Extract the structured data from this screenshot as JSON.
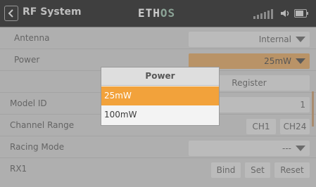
{
  "header": {
    "title": "RF System",
    "logo_a": "ETH",
    "logo_b": "OS"
  },
  "rows": {
    "antenna": {
      "label": "Antenna",
      "value": "Internal"
    },
    "power": {
      "label": "Power",
      "value": "25mW"
    },
    "register": {
      "label": "Register"
    },
    "model_id": {
      "label": "Model ID",
      "value": "1"
    },
    "channel_range": {
      "label": "Channel Range",
      "start": "CH1",
      "end": "CH24"
    },
    "racing_mode": {
      "label": "Racing Mode",
      "value": "---"
    },
    "rx1": {
      "label": "RX1",
      "bind": "Bind",
      "set": "Set",
      "reset": "Reset"
    }
  },
  "popup": {
    "title": "Power",
    "options": [
      "25mW",
      "100mW"
    ],
    "selected": "25mW"
  },
  "colors": {
    "accent": "#f2a23b",
    "header_bg": "#3d3d3d",
    "content_bg": "#c6c6c6"
  },
  "icons": [
    "back-arrow-icon",
    "signal-icon",
    "volume-icon",
    "battery-icon",
    "chevron-down-icon"
  ],
  "battery_level": 0.75
}
